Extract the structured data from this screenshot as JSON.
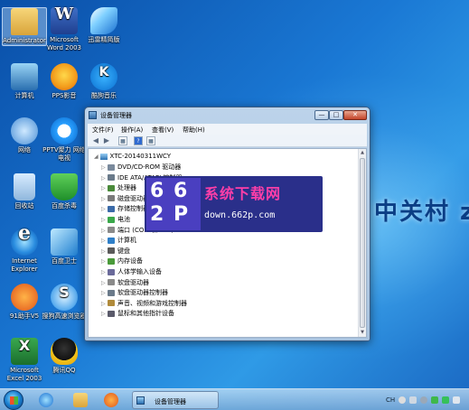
{
  "desktop": {
    "icons": [
      {
        "label": "Administrator",
        "icon": "user-folder-icon"
      },
      {
        "label": "Microsoft Word 2003",
        "icon": "word-icon"
      },
      {
        "label": "迅雷精简版",
        "icon": "thunder-icon"
      },
      {
        "label": "计算机",
        "icon": "computer-icon"
      },
      {
        "label": "PPS影音",
        "icon": "pps-icon"
      },
      {
        "label": "酷狗音乐",
        "icon": "kugou-icon"
      },
      {
        "label": "网络",
        "icon": "network-icon"
      },
      {
        "label": "PPTV聚力 网络电视",
        "icon": "pptv-icon"
      },
      {
        "label": "回收站",
        "icon": "recycle-bin-icon"
      },
      {
        "label": "百度杀毒",
        "icon": "baidu-antivirus-icon"
      },
      {
        "label": "Internet Explorer",
        "icon": "ie-icon"
      },
      {
        "label": "百度卫士",
        "icon": "baidu-guard-icon"
      },
      {
        "label": "91助手V5",
        "icon": "91-assistant-icon"
      },
      {
        "label": "搜狗高速浏览器",
        "icon": "sogou-browser-icon"
      },
      {
        "label": "Microsoft Excel 2003",
        "icon": "excel-icon"
      },
      {
        "label": "腾讯QQ",
        "icon": "qq-icon"
      }
    ],
    "wallpaper_text": "中关村 z"
  },
  "window": {
    "title": "设备管理器",
    "menu": [
      "文件(F)",
      "操作(A)",
      "查看(V)",
      "帮助(H)"
    ],
    "min_glyph": "—",
    "max_glyph": "□",
    "close_glyph": "✕",
    "toolbar": {
      "back": "◀",
      "forward": "▶",
      "box1": "▦",
      "help": "?",
      "box2": "▦"
    },
    "tree_root": "XTC-20140311WCY",
    "tree_items": [
      "DVD/CD-ROM 驱动器",
      "IDE ATA/ATAPI 控制器",
      "处理器",
      "磁盘驱动器",
      "存储控制器",
      "电池",
      "端口 (COM 和 LPT)",
      "计算机",
      "键盘",
      "内存设备",
      "人体学输入设备",
      "软盘驱动器",
      "软盘驱动器控制器",
      "声音、视频和游戏控制器",
      "鼠标和其他指针设备"
    ],
    "tree_expander": "▷",
    "scroll_up": "▲",
    "scroll_down": "▼"
  },
  "watermark": {
    "logo_chars": [
      "6",
      "6",
      "2",
      "P"
    ],
    "title": "系统下载网",
    "url": "down.662p.com"
  },
  "taskbar": {
    "task_label": "设备管理器",
    "tray_text": "CH"
  },
  "colors": {
    "desktop_bg": "#1a78d4",
    "watermark_bg": "#2a2f8a",
    "watermark_title": "#ff3ea8",
    "close_button": "#c4452a"
  }
}
